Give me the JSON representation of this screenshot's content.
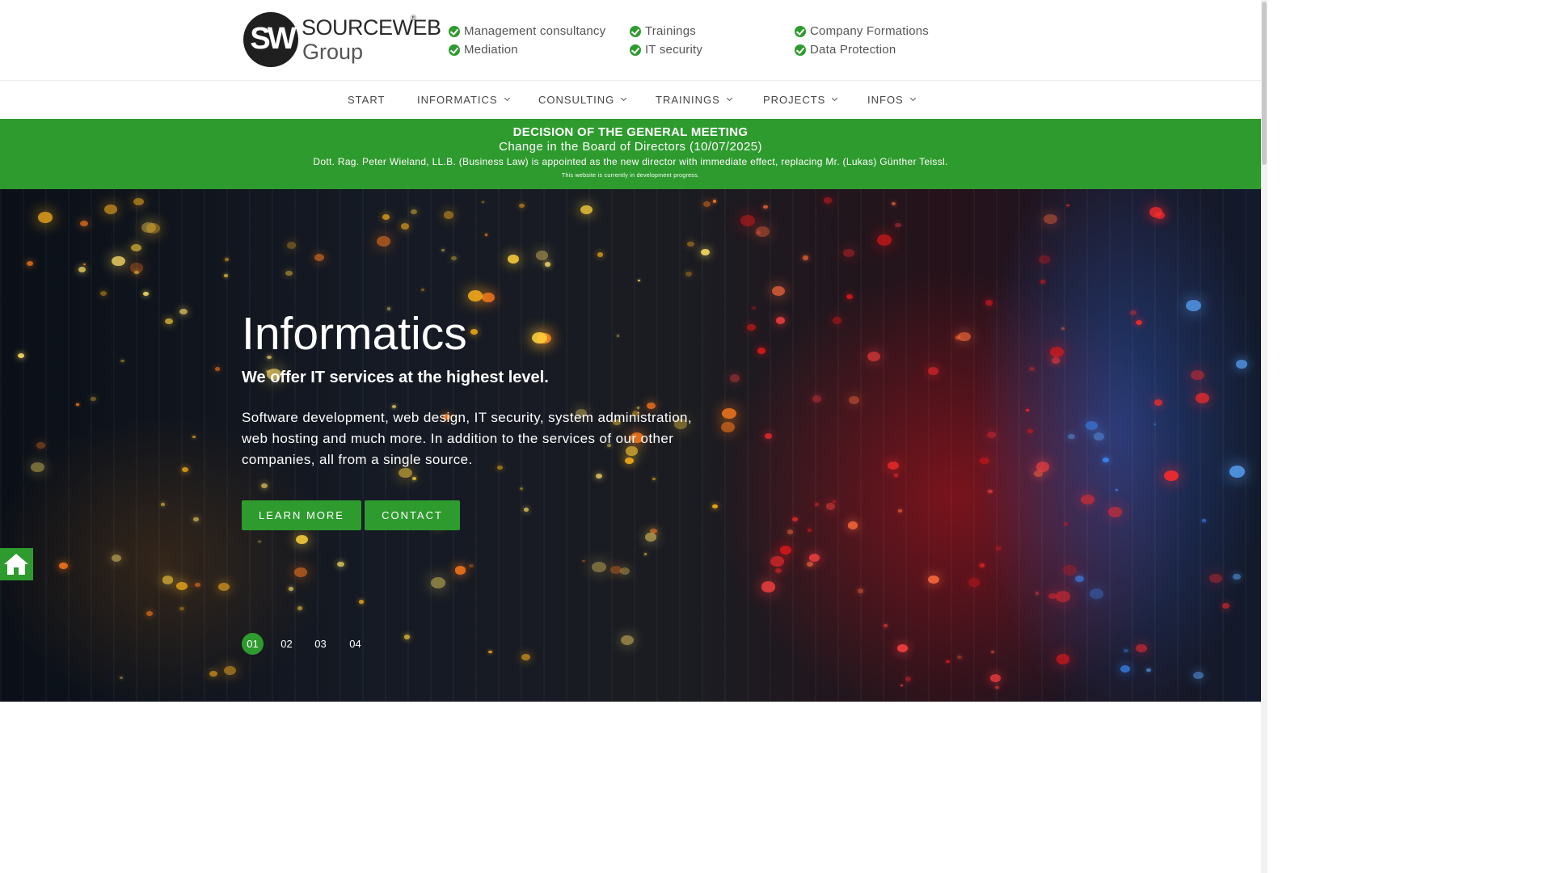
{
  "logo": {
    "mark": "SW",
    "name": "SOURCEWEB",
    "reg": "®",
    "sub": "Group"
  },
  "services": [
    "Management consultancy",
    "Mediation",
    "Trainings",
    "IT security",
    "Company Formations",
    "Data Protection"
  ],
  "nav": {
    "start": "START",
    "informatics": "INFORMATICS",
    "consulting": "CONSULTING",
    "trainings": "TRAININGS",
    "projects": "PROJECTS",
    "infos": "INFOS"
  },
  "banner": {
    "heading": "DECISION OF THE GENERAL MEETING",
    "subheading": "Change in the Board of Directors (10/07/2025)",
    "text": "Dott. Rag. Peter Wieland, LL.B. (Business Law) is appointed as the new director with immediate effect, replacing Mr. (Lukas) Günther Teissl.",
    "note": "This website is currently in development progress."
  },
  "hero": {
    "title": "Informatics",
    "subtitle": "We offer IT services at the highest level.",
    "text": "Software development, web design, IT security, system administration, web hosting and much more. In addition to the services of our other companies, all from a single source.",
    "learn_more": "LEARN MORE",
    "contact": "CONTACT"
  },
  "slides": [
    "01",
    "02",
    "03",
    "04"
  ],
  "colors": {
    "accent": "#2e9b2e",
    "text": "#555555"
  },
  "icons": {
    "check": "check-circle-icon",
    "home": "home-icon",
    "caret": "chevron-down-icon"
  }
}
